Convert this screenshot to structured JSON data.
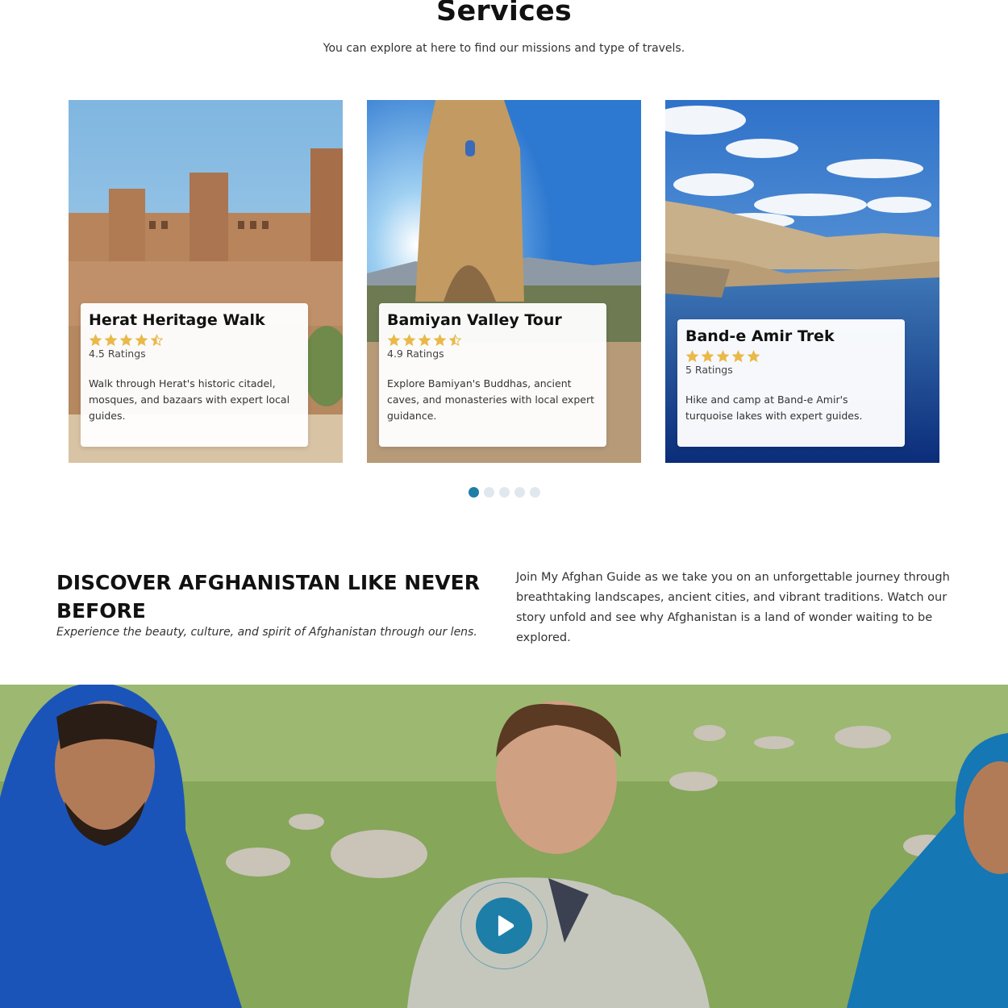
{
  "services": {
    "title": "Services",
    "subtitle": "You can explore at here to find our missions and type of travels."
  },
  "cards": [
    {
      "title": "Herat Heritage Walk",
      "rating_value": 4.5,
      "rating_text": "4.5 Ratings",
      "description": "Walk through Herat's historic citadel, mosques, and bazaars with expert local guides."
    },
    {
      "title": "Bamiyan Valley Tour",
      "rating_value": 4.9,
      "rating_text": "4.9 Ratings",
      "description": "Explore Bamiyan's Buddhas, ancient caves, and monasteries with local expert guidance."
    },
    {
      "title": "Band-e Amir Trek",
      "rating_value": 5,
      "rating_text": "5 Ratings",
      "description": "Hike and camp at Band-e Amir's turquoise lakes with expert guides."
    }
  ],
  "carousel": {
    "count": 5,
    "active_index": 0
  },
  "discover": {
    "heading": "DISCOVER AFGHANISTAN LIKE NEVER BEFORE",
    "tagline": "Experience the beauty, culture, and spirit of Afghanistan through our lens.",
    "paragraph": "Join My Afghan Guide as we take you on an unforgettable journey through breathtaking landscapes, ancient cities, and vibrant traditions. Watch our story unfold and see why Afghanistan is a land of wonder waiting to be explored."
  },
  "colors": {
    "accent": "#1d7ea8",
    "star": "#e9b949",
    "dot_inactive": "#dfe8ec"
  },
  "icons": {
    "star": "star-icon",
    "half_star": "star-half-icon",
    "play": "play-icon"
  }
}
